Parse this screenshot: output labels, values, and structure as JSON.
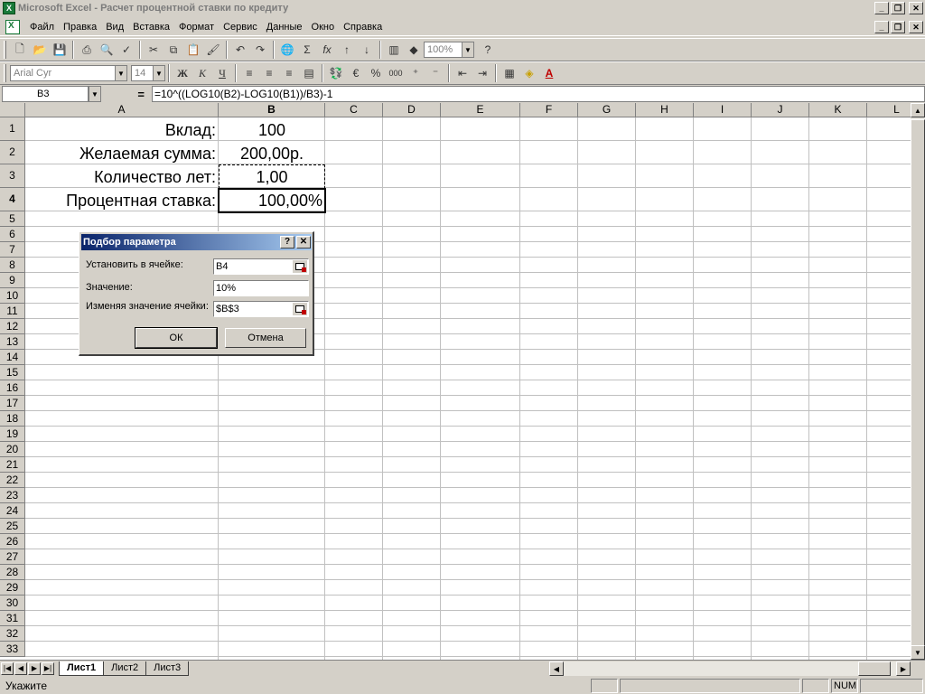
{
  "window": {
    "title": "Microsoft Excel - Расчет процентной ставки по кредиту",
    "minimize": "_",
    "restore": "❐",
    "close": "✕"
  },
  "menu": {
    "items": [
      "Файл",
      "Правка",
      "Вид",
      "Вставка",
      "Формат",
      "Сервис",
      "Данные",
      "Окно",
      "Справка"
    ]
  },
  "toolbar": {
    "zoom": "100%",
    "font_name": "Arial Cyr",
    "font_size": "14",
    "bold": "Ж",
    "italic": "К",
    "underline": "Ч",
    "euro": "€",
    "percent": "%",
    "thousands": "000",
    "font_color_letter": "A"
  },
  "formula_bar": {
    "name_box": "B3",
    "eq": "=",
    "formula": "=10^((LOG10(B2)-LOG10(B1))/B3)-1"
  },
  "columns": [
    "A",
    "B",
    "C",
    "D",
    "E",
    "F",
    "G",
    "H",
    "I",
    "J",
    "K",
    "L"
  ],
  "rows": [
    "1",
    "2",
    "3",
    "4",
    "5",
    "6",
    "7",
    "8",
    "9",
    "10",
    "11",
    "12",
    "13",
    "14",
    "15",
    "16",
    "17",
    "18",
    "19",
    "20",
    "21",
    "22",
    "23",
    "24",
    "25",
    "26",
    "27",
    "28",
    "29",
    "30",
    "31",
    "32",
    "33"
  ],
  "cells": {
    "A1": "Вклад:",
    "B1": "100",
    "A2": "Желаемая сумма:",
    "B2": "200,00р.",
    "A3": "Количество лет:",
    "B3": "1,00",
    "A4": "Процентная ставка:",
    "B4": "100,00%"
  },
  "dialog": {
    "title": "Подбор параметра",
    "help": "?",
    "close": "✕",
    "set_cell_label": "Установить в ячейке:",
    "set_cell_value": "B4",
    "value_label": "Значение:",
    "value_value": "10%",
    "changing_label": "Изменяя значение ячейки:",
    "changing_value": "$B$3",
    "ok": "ОК",
    "cancel": "Отмена"
  },
  "sheets": [
    "Лист1",
    "Лист2",
    "Лист3"
  ],
  "status": {
    "text": "Укажите",
    "num": "NUM"
  }
}
